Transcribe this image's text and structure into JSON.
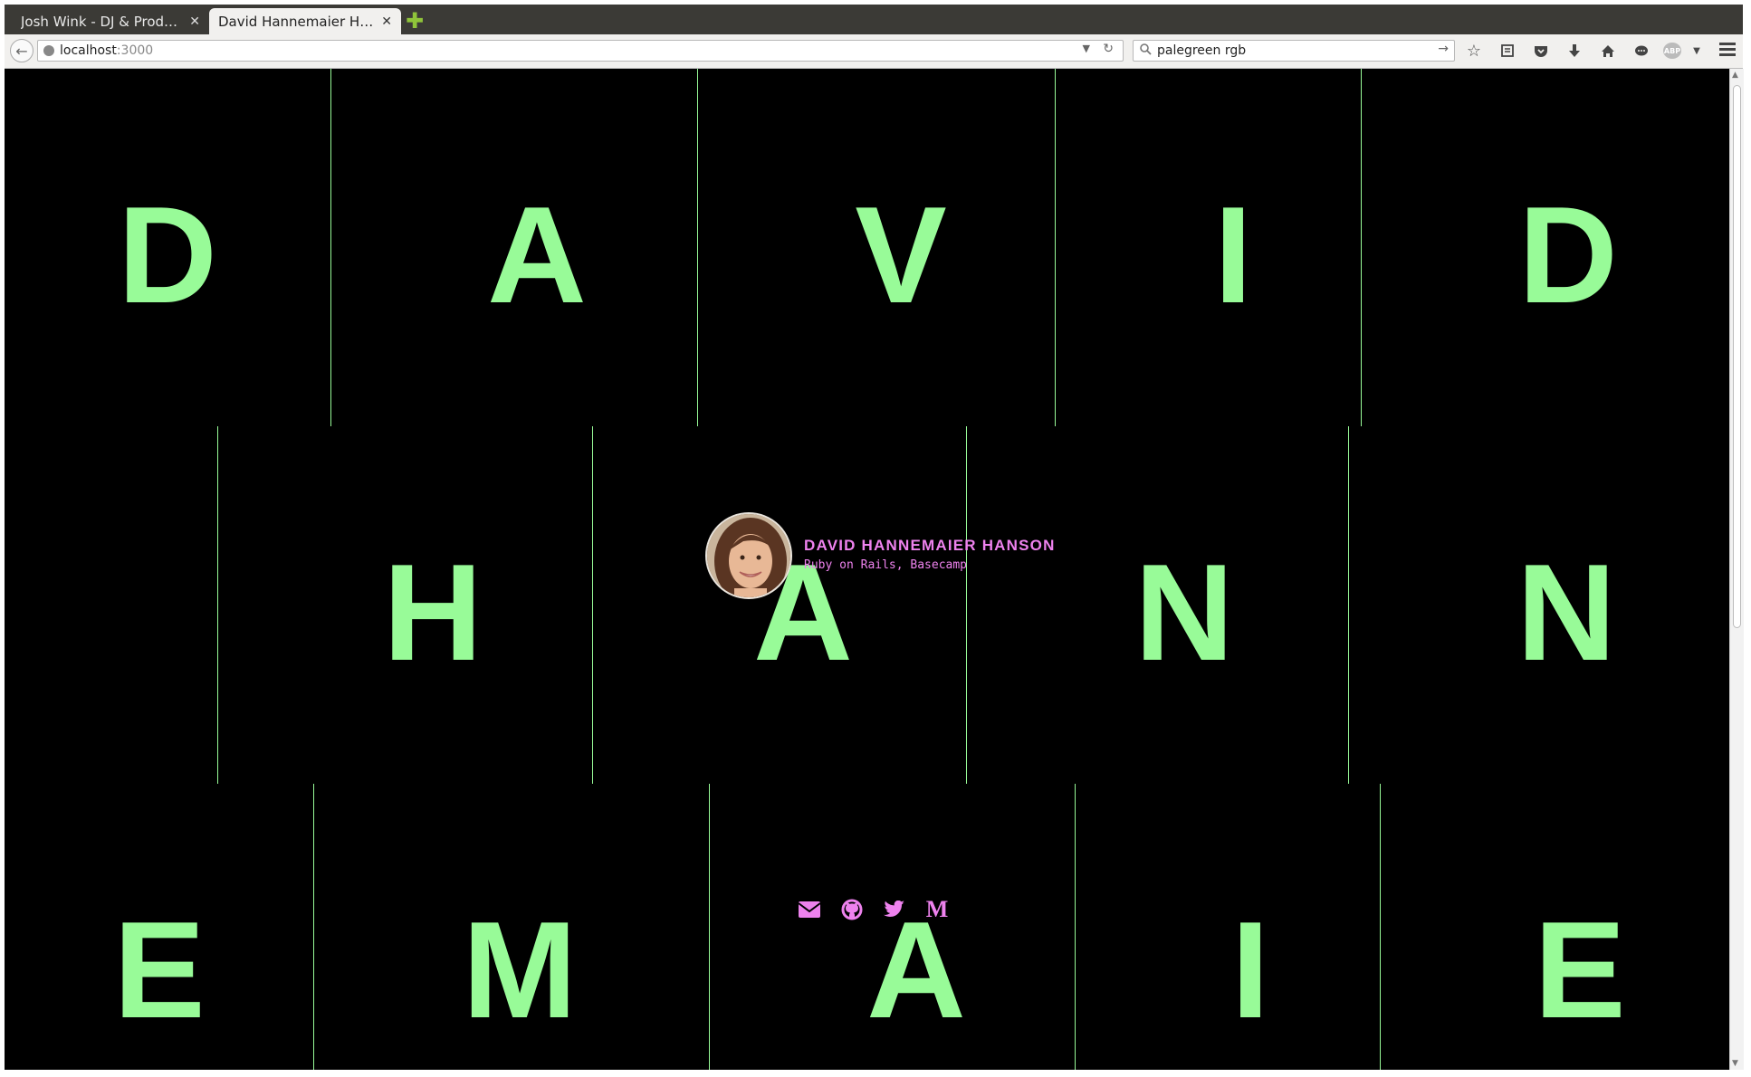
{
  "browser": {
    "tabs": [
      {
        "title": "Josh Wink - DJ & Producer",
        "active": false
      },
      {
        "title": "David Hannemaier Hans…",
        "active": true
      }
    ],
    "url_host": "localhost",
    "url_port": ":3000",
    "search_value": "palegreen rgb",
    "abp_label": "ABP"
  },
  "page": {
    "colors": {
      "background": "#000000",
      "accent_green": "#98fb98",
      "accent_pink": "#ee82ee"
    },
    "rows": [
      {
        "letters": [
          "D",
          "A",
          "V",
          "I",
          "D"
        ]
      },
      {
        "letters": [
          "H",
          "A",
          "N",
          "N"
        ]
      },
      {
        "letters": [
          "E",
          "M",
          "A",
          "I",
          "E"
        ]
      }
    ],
    "profile": {
      "name": "DAVID HANNEMAIER HANSON",
      "subtitle": "Ruby on Rails, Basecamp"
    },
    "social_icons": [
      "email-icon",
      "github-icon",
      "twitter-icon",
      "medium-icon"
    ],
    "medium_glyph": "M"
  }
}
